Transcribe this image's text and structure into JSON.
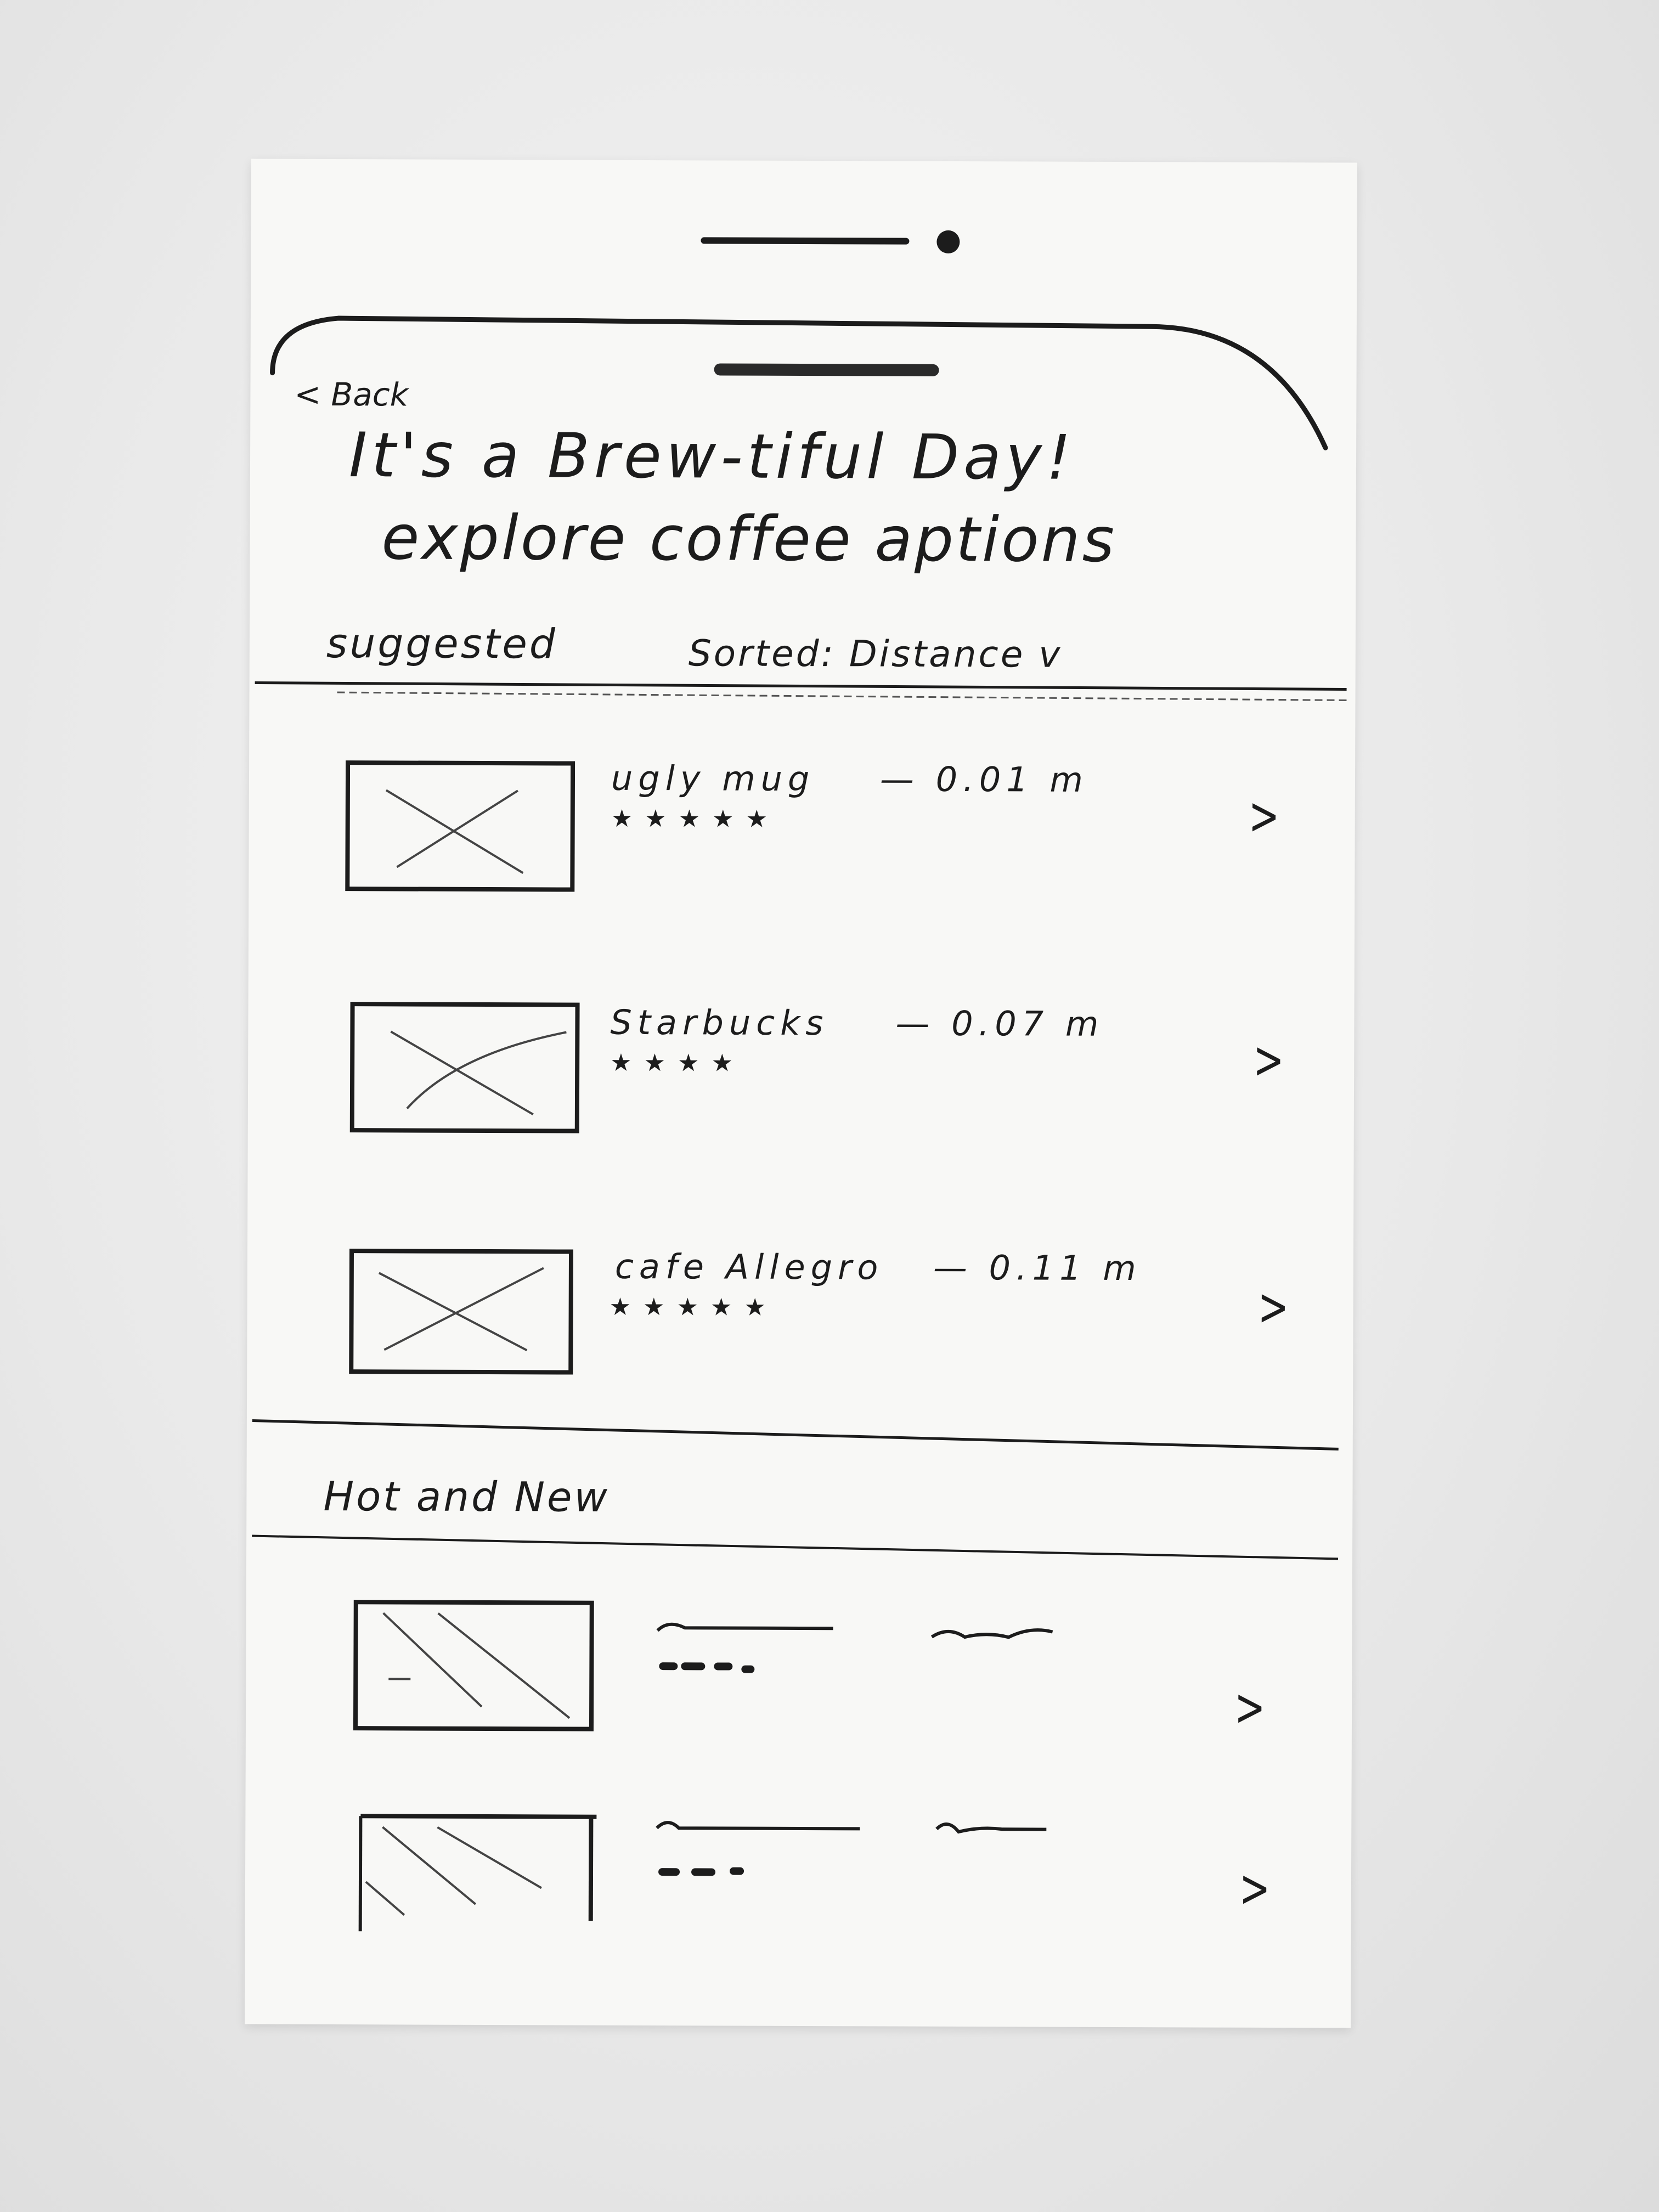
{
  "header": {
    "back_label": "< Back",
    "title": "It's a Brew-tiful Day!",
    "subtitle": "explore coffee aptions"
  },
  "suggested": {
    "label": "suggested",
    "sort_label": "Sorted: Distance v",
    "items": [
      {
        "name": "ugly mug",
        "distance": "— 0.01 m",
        "rating": "★★★★★",
        "chevron": ">"
      },
      {
        "name": "Starbucks",
        "distance": "— 0.07 m",
        "rating": "★★★★",
        "chevron": ">"
      },
      {
        "name": "cafe Allegro",
        "distance": "— 0.11 m",
        "rating": "★★★★★",
        "chevron": ">"
      }
    ]
  },
  "hot_and_new": {
    "label": "Hot and New",
    "items": [
      {
        "chevron": ">"
      },
      {
        "chevron": ">"
      }
    ]
  }
}
